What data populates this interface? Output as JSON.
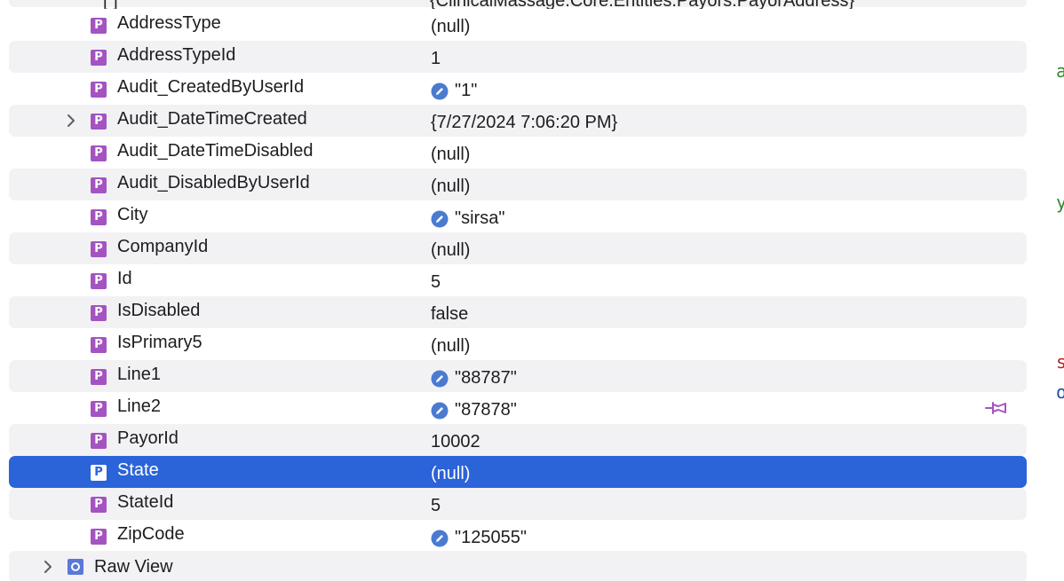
{
  "truncated_top": {
    "name": "[ ]",
    "value": "{ClinicalMassage.Core.Entities.Payors.PayorAddress}"
  },
  "rows": [
    {
      "name": "AddressType",
      "value": "(null)",
      "editable": false,
      "expandable": false,
      "badge": "P"
    },
    {
      "name": "AddressTypeId",
      "value": "1",
      "editable": false,
      "expandable": false,
      "badge": "P"
    },
    {
      "name": "Audit_CreatedByUserId",
      "value": "\"1\"",
      "editable": true,
      "expandable": false,
      "badge": "P"
    },
    {
      "name": "Audit_DateTimeCreated",
      "value": "{7/27/2024 7:06:20 PM}",
      "editable": false,
      "expandable": true,
      "badge": "P"
    },
    {
      "name": "Audit_DateTimeDisabled",
      "value": "(null)",
      "editable": false,
      "expandable": false,
      "badge": "P"
    },
    {
      "name": "Audit_DisabledByUserId",
      "value": "(null)",
      "editable": false,
      "expandable": false,
      "badge": "P"
    },
    {
      "name": "City",
      "value": "\"sirsa\"",
      "editable": true,
      "expandable": false,
      "badge": "P"
    },
    {
      "name": "CompanyId",
      "value": "(null)",
      "editable": false,
      "expandable": false,
      "badge": "P"
    },
    {
      "name": "Id",
      "value": "5",
      "editable": false,
      "expandable": false,
      "badge": "P"
    },
    {
      "name": "IsDisabled",
      "value": "false",
      "editable": false,
      "expandable": false,
      "badge": "P"
    },
    {
      "name": "IsPrimary5",
      "value": "(null)",
      "editable": false,
      "expandable": false,
      "badge": "P"
    },
    {
      "name": "Line1",
      "value": "\"88787\"",
      "editable": true,
      "expandable": false,
      "badge": "P"
    },
    {
      "name": "Line2",
      "value": "\"87878\"",
      "editable": true,
      "expandable": false,
      "badge": "P",
      "pinned_icon": true
    },
    {
      "name": "PayorId",
      "value": "10002",
      "editable": false,
      "expandable": false,
      "badge": "P"
    },
    {
      "name": "State",
      "value": "(null)",
      "editable": false,
      "expandable": false,
      "badge": "P",
      "selected": true
    },
    {
      "name": "StateId",
      "value": "5",
      "editable": false,
      "expandable": false,
      "badge": "P"
    },
    {
      "name": "ZipCode",
      "value": "\"125055\"",
      "editable": true,
      "expandable": false,
      "badge": "P"
    }
  ],
  "raw_view": {
    "label": "Raw View",
    "expandable": true
  },
  "colors": {
    "row_alt": "#f2f2f4",
    "selection": "#2b63d9",
    "property_badge": "#a553c1",
    "edit_icon": "#4a7bd0",
    "pin_icon": "#a553c1",
    "raw_view_icon": "#5a78d8"
  },
  "icons": {
    "property": "property-badge-icon",
    "edit": "pencil-edit-icon",
    "expand": "chevron-right-icon",
    "pin": "pin-icon",
    "raw_view": "raw-view-icon"
  }
}
